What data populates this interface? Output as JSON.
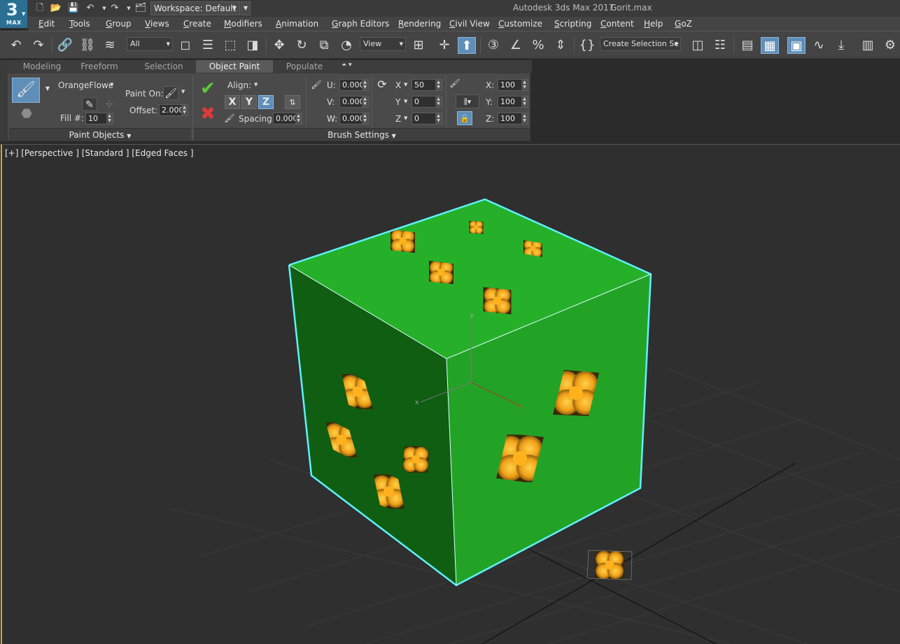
{
  "titlebar": {
    "logo_number": "3",
    "logo_text": "MAX",
    "workspace_label": "Workspace: Default",
    "app_title": "Autodesk 3ds Max 2017",
    "file_title": "Gorit.max"
  },
  "menu": [
    {
      "label": "Edit"
    },
    {
      "label": "Tools"
    },
    {
      "label": "Group"
    },
    {
      "label": "Views"
    },
    {
      "label": "Create"
    },
    {
      "label": "Modifiers"
    },
    {
      "label": "Animation"
    },
    {
      "label": "Graph Editors"
    },
    {
      "label": "Rendering"
    },
    {
      "label": "Civil View"
    },
    {
      "label": "Customize"
    },
    {
      "label": "Scripting"
    },
    {
      "label": "Content"
    },
    {
      "label": "Help"
    },
    {
      "label": "GoZ"
    }
  ],
  "toolbar": {
    "selection_filter": "All",
    "reference_coord": "View",
    "named_selection": "Create Selection Se"
  },
  "ribbon_tabs": [
    {
      "label": "Modeling"
    },
    {
      "label": "Freeform"
    },
    {
      "label": "Selection"
    },
    {
      "label": "Object Paint",
      "active": true
    },
    {
      "label": "Populate"
    }
  ],
  "ribbon": {
    "paint_objects": {
      "object_name": "OrangeFlowe",
      "fill_label": "Fill #:",
      "fill_value": "10",
      "paint_on_label": "Paint On:",
      "offset_label": "Offset:",
      "offset_value": "2.000",
      "panel_title": "Paint Objects"
    },
    "brush_settings": {
      "align_label": "Align:",
      "axes": [
        "X",
        "Y",
        "Z"
      ],
      "active_axis": "Z",
      "spacing_label": "Spacing:",
      "spacing_value": "0.000",
      "u_label": "U:",
      "u_value": "0.000",
      "v_label": "V:",
      "v_value": "0.000",
      "w_label": "W:",
      "w_value": "0.000",
      "rot_x_label": "X",
      "rot_x_value": "50",
      "rot_y_label": "Y",
      "rot_y_value": "0",
      "rot_z_label": "Z",
      "rot_z_value": "0",
      "scale_x_label": "X:",
      "scale_x_value": "100",
      "scale_y_label": "Y:",
      "scale_y_value": "100",
      "scale_z_label": "Z:",
      "scale_z_value": "100",
      "panel_title": "Brush Settings"
    }
  },
  "viewport": {
    "label": "[+] [Perspective ] [Standard ] [Edged Faces ]",
    "axis_x": "x",
    "axis_y": "y",
    "axis_z": "z",
    "colors": {
      "background": "#2f2f2f",
      "grid": "#3b3b3b",
      "cube_top": "#26b02a",
      "cube_left": "#0f5e12",
      "cube_right": "#23a326",
      "selection_outline": "#5ff0ff",
      "flower": "#f0a018",
      "active_border": "#d6a53a"
    }
  },
  "colors": {
    "accent": "#5f8fb8",
    "accept_green": "#5ec93a",
    "cancel_red": "#e03a3a"
  }
}
